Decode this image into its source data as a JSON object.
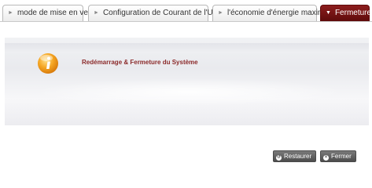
{
  "tabs": [
    {
      "label": "mode de mise en veille",
      "active": false
    },
    {
      "label": "Configuration de Courant de l'UPS",
      "active": false
    },
    {
      "label": "l'économie d'énergie maximale",
      "active": false
    },
    {
      "label": "Fermeture",
      "active": true
    }
  ],
  "panel": {
    "title": "Redémarrage & Fermeture du Système",
    "icon": "info-icon"
  },
  "buttons": {
    "restore_label": "Restaurer",
    "close_label": "Fermer"
  },
  "colors": {
    "active_tab": "#7a1414",
    "title": "#8b2a2a",
    "button": "#5e5e5e"
  }
}
